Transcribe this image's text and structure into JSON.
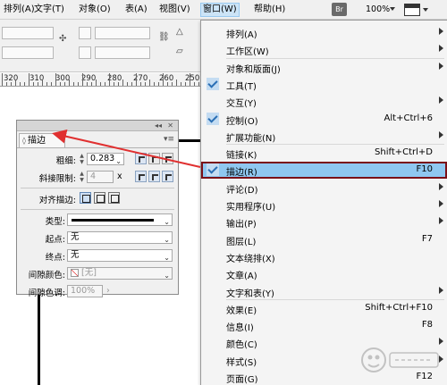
{
  "menubar": {
    "items": [
      "排列(A)",
      "文字(T)",
      "对象(O)",
      "表(A)",
      "视图(V)",
      "窗口(W)",
      "帮助(H)"
    ],
    "br_label": "Br",
    "zoom": "100%"
  },
  "ruler": {
    "labels": [
      "320",
      "310",
      "300",
      "290",
      "280",
      "270",
      "260",
      "250"
    ]
  },
  "stroke_panel": {
    "title": "描边",
    "weight_label": "粗细:",
    "weight_value": "0.283",
    "miter_label": "斜接限制:",
    "miter_value": "4",
    "miter_suffix": "x",
    "align_label": "对齐描边:",
    "type_label": "类型:",
    "start_label": "起点:",
    "start_value": "无",
    "end_label": "终点:",
    "end_value": "无",
    "gap_color_label": "间隙颜色:",
    "gap_color_value": "[无]",
    "gap_tint_label": "间隙色调:",
    "gap_tint_value": "100%"
  },
  "window_menu": {
    "items": [
      {
        "label": "排列(A)",
        "shortcut": "",
        "submenu": true,
        "checked": false
      },
      {
        "label": "工作区(W)",
        "shortcut": "",
        "submenu": true,
        "checked": false
      },
      {
        "label": "对象和版面(J)",
        "shortcut": "",
        "submenu": true,
        "checked": false
      },
      {
        "label": "工具(T)",
        "shortcut": "",
        "submenu": false,
        "checked": true
      },
      {
        "label": "交互(Y)",
        "shortcut": "",
        "submenu": true,
        "checked": false
      },
      {
        "label": "控制(O)",
        "shortcut": "Alt+Ctrl+6",
        "submenu": false,
        "checked": true
      },
      {
        "label": "扩展功能(N)",
        "shortcut": "",
        "submenu": true,
        "checked": false
      },
      {
        "label": "链接(K)",
        "shortcut": "Shift+Ctrl+D",
        "submenu": false,
        "checked": false
      },
      {
        "label": "描边(R)",
        "shortcut": "F10",
        "submenu": false,
        "checked": true,
        "highlight": true
      },
      {
        "label": "评论(D)",
        "shortcut": "",
        "submenu": true,
        "checked": false
      },
      {
        "label": "实用程序(U)",
        "shortcut": "",
        "submenu": true,
        "checked": false
      },
      {
        "label": "输出(P)",
        "shortcut": "",
        "submenu": true,
        "checked": false
      },
      {
        "label": "图层(L)",
        "shortcut": "F7",
        "submenu": false,
        "checked": false
      },
      {
        "label": "文本绕排(X)",
        "shortcut": "",
        "submenu": false,
        "checked": false
      },
      {
        "label": "文章(A)",
        "shortcut": "",
        "submenu": false,
        "checked": false
      },
      {
        "label": "文字和表(Y)",
        "shortcut": "",
        "submenu": true,
        "checked": false
      },
      {
        "label": "效果(E)",
        "shortcut": "Shift+Ctrl+F10",
        "submenu": false,
        "checked": false
      },
      {
        "label": "信息(I)",
        "shortcut": "F8",
        "submenu": false,
        "checked": false
      },
      {
        "label": "颜色(C)",
        "shortcut": "",
        "submenu": true,
        "checked": false
      },
      {
        "label": "样式(S)",
        "shortcut": "",
        "submenu": true,
        "checked": false
      },
      {
        "label": "页面(G)",
        "shortcut": "F12",
        "submenu": false,
        "checked": false
      }
    ]
  },
  "colors": {
    "highlight": "#8fc7f0",
    "highlight_border": "#7a1018",
    "callout": "#e03030",
    "check": "#2a6fb5"
  }
}
